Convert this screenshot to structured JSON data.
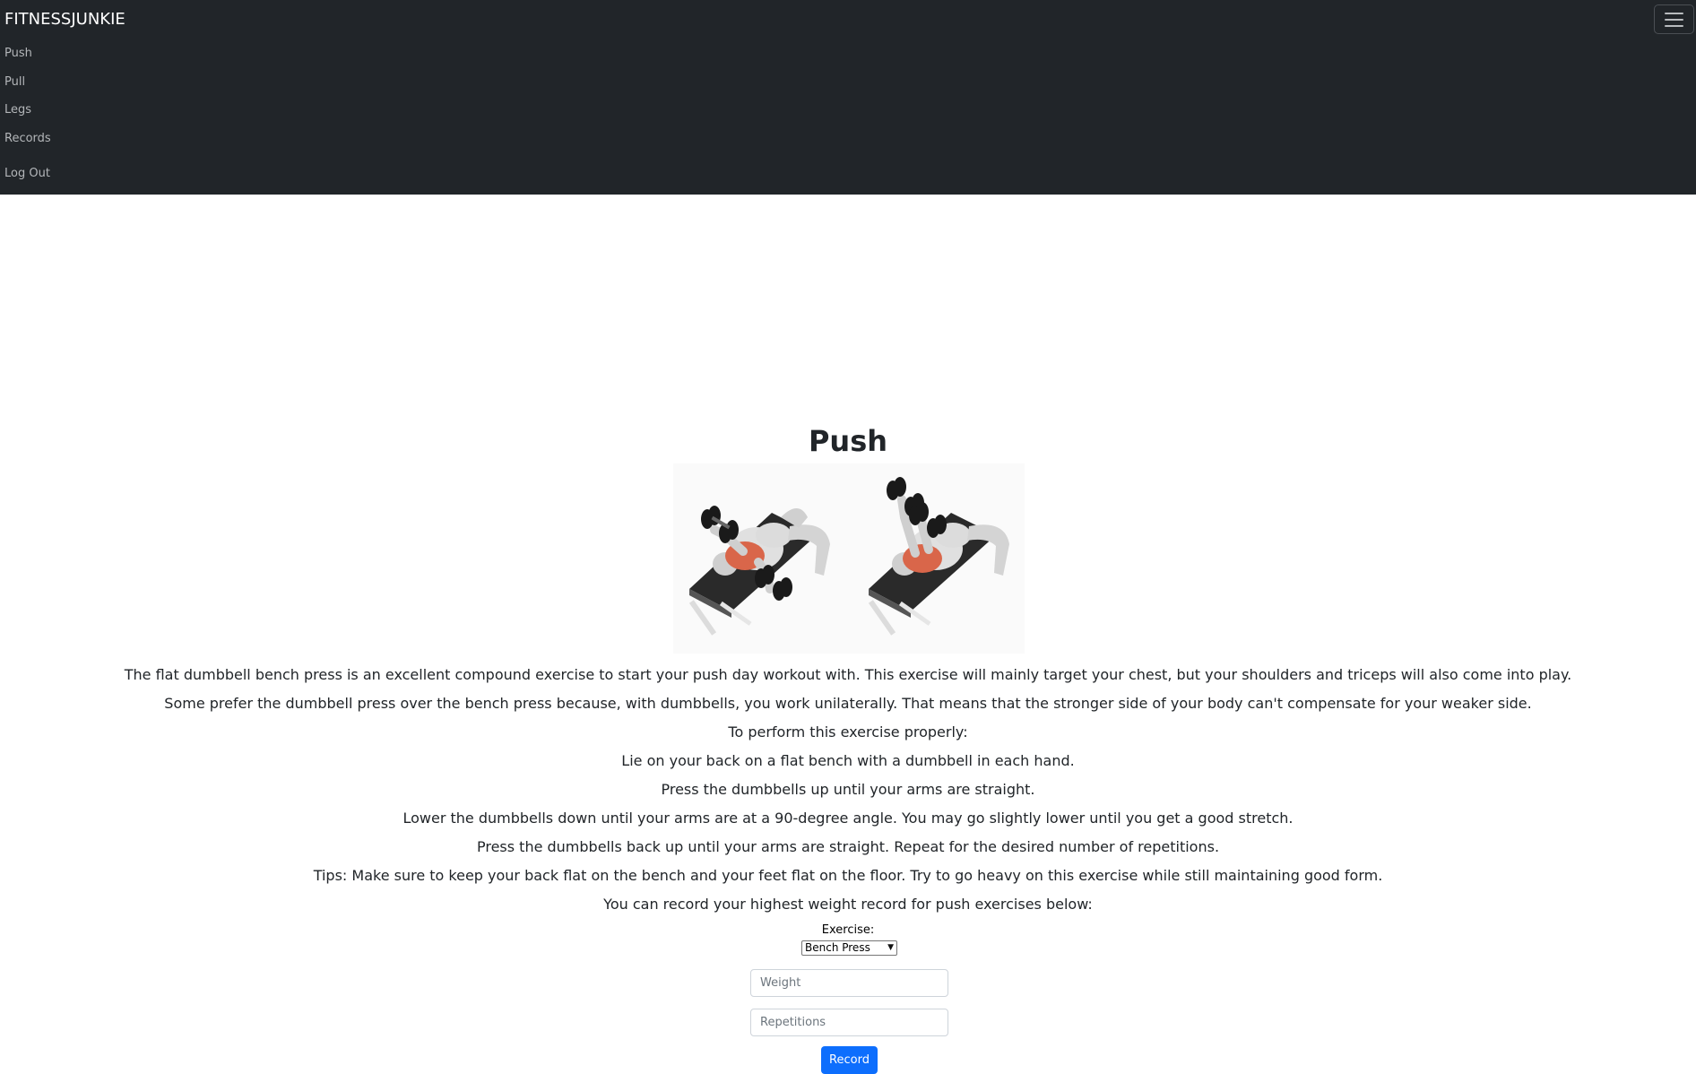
{
  "nav": {
    "brand": "FITNESSJUNKIE",
    "items": [
      {
        "label": "Push"
      },
      {
        "label": "Pull"
      },
      {
        "label": "Legs"
      },
      {
        "label": "Records"
      },
      {
        "label": "Log Out"
      }
    ],
    "toggler_icon": "hamburger-menu-icon"
  },
  "page": {
    "title": "Push",
    "image_subject": "flat dumbbell bench press illustration",
    "paragraphs": [
      "The flat dumbbell bench press is an excellent compound exercise to start your push day workout with. This exercise will mainly target your chest, but your shoulders and triceps will also come into play.",
      "Some prefer the dumbbell press over the bench press because, with dumbbells, you work unilaterally. That means that the stronger side of your body can't compensate for your weaker side.",
      "To perform this exercise properly:",
      "Lie on your back on a flat bench with a dumbbell in each hand.",
      "Press the dumbbells up until your arms are straight.",
      "Lower the dumbbells down until your arms are at a 90-degree angle. You may go slightly lower until you get a good stretch.",
      "Press the dumbbells back up until your arms are straight. Repeat for the desired number of repetitions.",
      "Tips: Make sure to keep your back flat on the bench and your feet flat on the floor. Try to go heavy on this exercise while still maintaining good form.",
      "You can record your highest weight record for push exercises below:"
    ]
  },
  "form": {
    "exercise_label": "Exercise:",
    "exercise_selected": "Bench Press",
    "weight_placeholder": "Weight",
    "reps_placeholder": "Repetitions",
    "submit_label": "Record"
  },
  "colors": {
    "navbar_bg": "#212529",
    "primary": "#0d6efd",
    "muscle_highlight": "#d9664a"
  }
}
